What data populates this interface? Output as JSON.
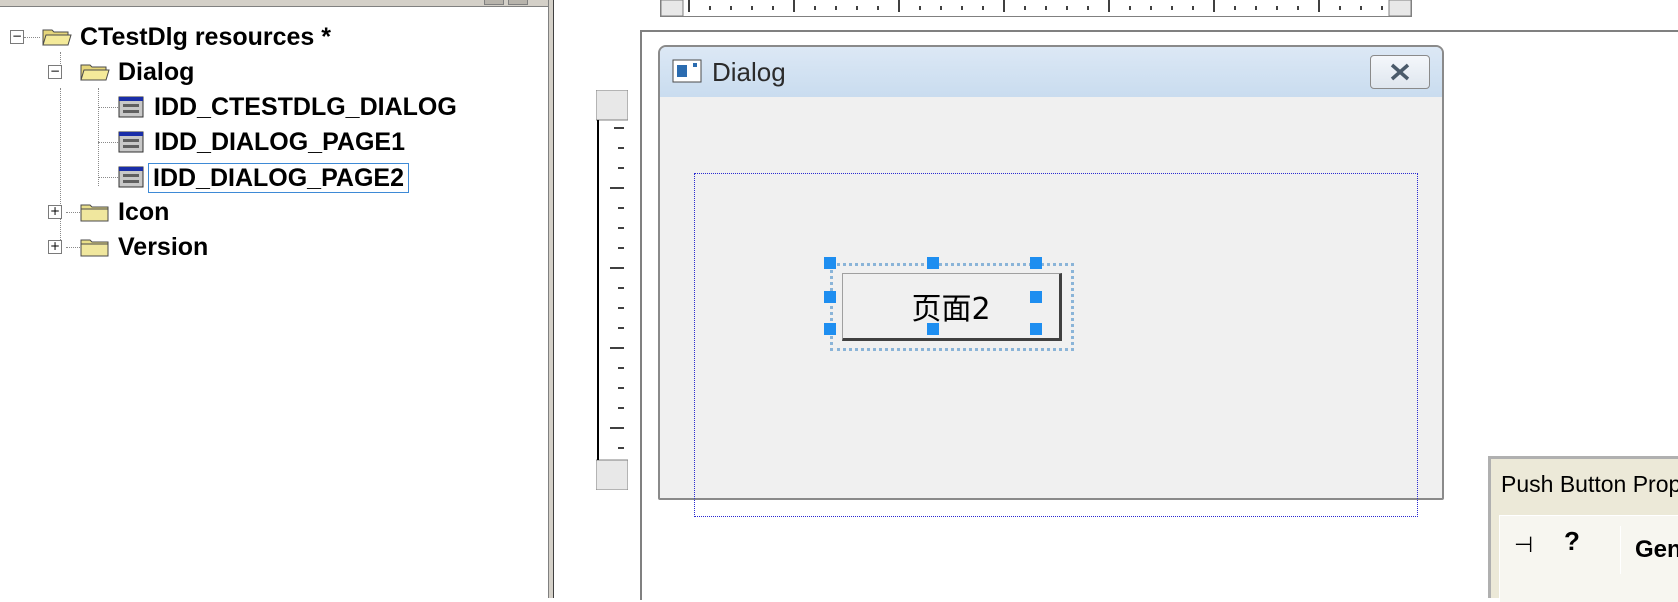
{
  "tree": {
    "root": {
      "label": "CTestDlg resources *",
      "expander": "−"
    },
    "dialog_folder": {
      "label": "Dialog",
      "expander": "−"
    },
    "dialogs": [
      {
        "label": "IDD_CTESTDLG_DIALOG",
        "selected": false
      },
      {
        "label": "IDD_DIALOG_PAGE1",
        "selected": false
      },
      {
        "label": "IDD_DIALOG_PAGE2",
        "selected": true
      }
    ],
    "icon_folder": {
      "label": "Icon",
      "expander": "+"
    },
    "version_folder": {
      "label": "Version",
      "expander": "+"
    }
  },
  "dialog_preview": {
    "title": "Dialog",
    "close_glyph": "✕",
    "button_label": "页面2"
  },
  "properties_window": {
    "title": "Push Button Properties",
    "pin_glyph": "⊣",
    "help_glyph": "?",
    "tab_label": "General"
  },
  "colors": {
    "selection_handle": "#1e8ef0",
    "guide_rect": "#2a2ad0",
    "dialog_bg": "#f0f0f0",
    "titlebar": "#c9dcef"
  }
}
